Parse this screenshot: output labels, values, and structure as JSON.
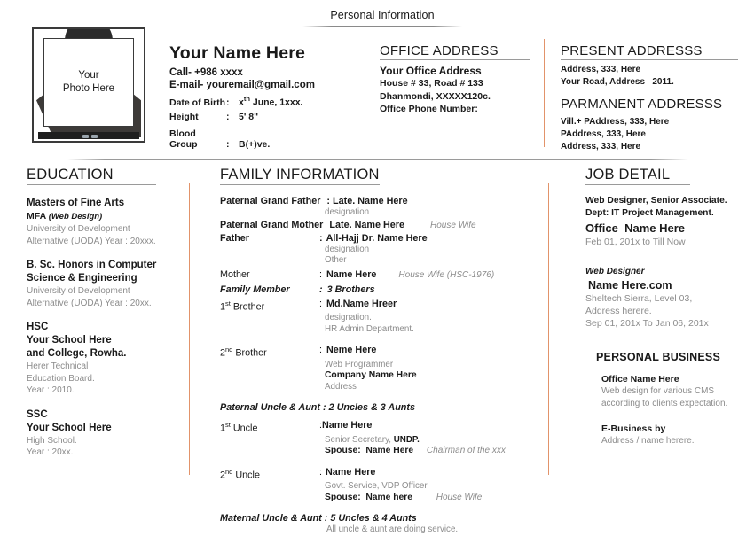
{
  "document": {
    "title": "Personal Information"
  },
  "photo": {
    "line1": "Your",
    "line2": "Photo Here"
  },
  "personal": {
    "name": "Your Name Here",
    "call": "Call-  +986 xxxx",
    "email": "E-mail-   youremail@gmail.com",
    "fields": [
      {
        "label": "Date of Birth",
        "sep": ":",
        "value_pre": "x",
        "value_sup": "th",
        "value_post": " June, 1xxx."
      },
      {
        "label": "Height",
        "sep": ":",
        "value_pre": "5' 8\"",
        "value_sup": "",
        "value_post": ""
      },
      {
        "label": "Blood Group",
        "sep": ":",
        "value_pre": "B(+)ve.",
        "value_sup": "",
        "value_post": ""
      }
    ]
  },
  "office_address": {
    "heading": "OFFICE ADDRESS",
    "subheading": "Your Office Address",
    "lines": [
      "House # 33, Road # 133",
      "Dhanmondi, XXXXX120c.",
      "Office Phone Number:"
    ]
  },
  "present_address": {
    "heading": "PRESENT  ADDRESSS",
    "lines": [
      "Address, 333, Here",
      "Your Road, Address– 2011."
    ]
  },
  "permanent_address": {
    "heading": "PARMANENT ADDRESSS",
    "lines": [
      "Vill.+ PAddress, 333, Here",
      "PAddress, 333, Here",
      "Address, 333, Here"
    ]
  },
  "education": {
    "heading": "EDUCATION",
    "items": [
      {
        "title": "Masters of Fine Arts",
        "subtitle_pre": "MFA ",
        "subtitle_italic": "(Web Design)",
        "details": [
          "University of Development",
          "Alternative (UODA) Year : 20xxx."
        ]
      },
      {
        "title": "B. Sc. Honors in Computer",
        "title2": "Science & Engineering",
        "subtitle_pre": "",
        "subtitle_italic": "",
        "details": [
          "University of Development",
          "Alternative (UODA) Year : 20xx."
        ]
      },
      {
        "title": "HSC",
        "title2": "Your School Here",
        "title3": "and College, Rowha.",
        "details": [
          "Herer Technical",
          "Education Board.",
          "Year : 2010."
        ]
      },
      {
        "title": "SSC",
        "title2": "Your School Here",
        "details": [
          "High School.",
          "Year : 20xx."
        ]
      }
    ]
  },
  "family": {
    "heading": "FAMILY INFORMATION",
    "grandfather": {
      "label": "Paternal Grand Father",
      "value": ": Late. Name Here",
      "sub": "designation"
    },
    "grandmother": {
      "label": "Paternal Grand Mother",
      "value": "Late. Name Here",
      "note": "House Wife"
    },
    "father": {
      "label": "Father",
      "sep": ":",
      "value": "All-Hajj Dr. Name Here",
      "sub1": "designation",
      "sub2": "Other"
    },
    "mother": {
      "label": "Mother",
      "sep": ":",
      "value": "Name Here",
      "note": "House Wife (HSC-1976)"
    },
    "family_member": {
      "label": "Family Member",
      "sep": ":",
      "value": "3 Brothers"
    },
    "brother1": {
      "label_pre": "1",
      "label_sup": "st",
      "label_post": " Brother",
      "sep": ":",
      "value": "Md.Name Hreer",
      "sub1": "designation.",
      "sub2": "HR Admin Department."
    },
    "brother2": {
      "label_pre": "2",
      "label_sup": "nd",
      "label_post": " Brother",
      "sep": ":",
      "value": "Neme Here",
      "sub1": "Web Programmer",
      "sub2": "Company Name Here",
      "sub3": "Address"
    },
    "paternal_heading": "Paternal Uncle & Aunt : 2 Uncles & 3 Aunts",
    "uncle1": {
      "label_pre": "1",
      "label_sup": "st",
      "label_post": " Uncle",
      "sep": ":",
      "value": "Name Here",
      "sub1_pre": "Senior Secretary, ",
      "sub1_bold": "UNDP.",
      "spouse_label": "Spouse:",
      "spouse_value": "Name Here",
      "spouse_note": "Chairman of the xxx"
    },
    "uncle2": {
      "label_pre": "2",
      "label_sup": "nd",
      "label_post": " Uncle",
      "sep": ":",
      "value": "Name Here",
      "sub1": "Govt. Service, VDP Officer",
      "spouse_label": "Spouse:",
      "spouse_value": "Name here",
      "spouse_note": "House Wife"
    },
    "maternal_heading": "Maternal Uncle & Aunt : 5 Uncles & 4 Aunts",
    "maternal_note": "All uncle & aunt are doing service."
  },
  "job": {
    "heading": "JOB DETAIL",
    "current": {
      "line1": "Web Designer, Senior Associate.",
      "line2": "Dept: IT Project Management.",
      "office_pre": "Office",
      "office_name": "Name Here",
      "dates": "Feb 01, 201x to  Till Now"
    },
    "previous": {
      "role": "Web Designer",
      "domain": "Name Here.com",
      "address1": "Sheltech Sierra, Level 03,",
      "address2": "Address herere.",
      "dates": "Sep 01, 201x To Jan 06, 201x"
    }
  },
  "personal_business": {
    "heading": "PERSONAL BUSINESS",
    "item1": {
      "title": "Office Name Here",
      "desc1": "Web design for various CMS",
      "desc2": "according to clients expectation."
    },
    "item2": {
      "title": "E-Business by",
      "desc1": "Address / name herere."
    }
  },
  "colors": {
    "divider_accent": "#e2936a",
    "rule_gray": "#9a9a9a",
    "muted_text": "#8c8c8c",
    "body_text": "#1a1a1a"
  }
}
